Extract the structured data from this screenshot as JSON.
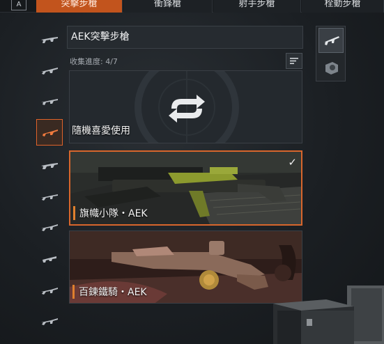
{
  "tabs": {
    "key_hint": "A",
    "items": [
      {
        "label": "突擊步槍",
        "active": true
      },
      {
        "label": "衝鋒槍",
        "active": false
      },
      {
        "label": "射手步槍",
        "active": false
      },
      {
        "label": "栓動步槍",
        "active": false
      }
    ]
  },
  "weapon_list": {
    "selected_index": 4,
    "count": 10
  },
  "main": {
    "title": "AEK突擊步槍",
    "progress_label": "收集進度:",
    "progress_value": "4/7",
    "cards": [
      {
        "label": "隨機喜愛使用",
        "icon": "shuffle-icon"
      },
      {
        "label": "旗幟小隊・AEK",
        "selected": true,
        "check": "✓"
      },
      {
        "label": "百鍊鐵騎・AEK",
        "selected": false
      }
    ]
  },
  "attachments": {
    "items": [
      {
        "icon": "rifle-icon",
        "selected": true
      },
      {
        "icon": "scope-icon",
        "selected": false
      }
    ]
  },
  "colors": {
    "accent": "#d8662c",
    "tab_active": "#c2541d"
  }
}
